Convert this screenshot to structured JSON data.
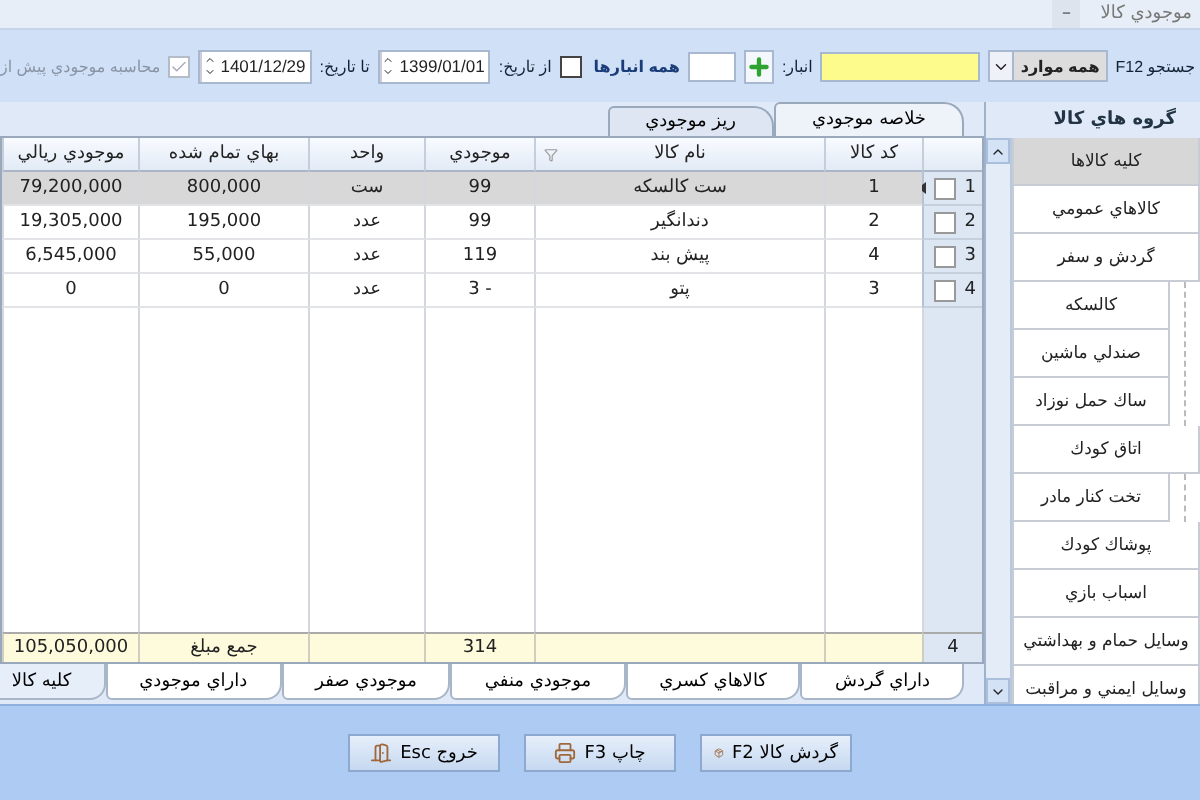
{
  "window": {
    "title": "موجودي كالا",
    "minimize": "–"
  },
  "toolbar": {
    "search_label": "جستجو F12",
    "filter_value": "همه موارد",
    "warehouse_label": "انبار:",
    "all_warehouses": "همه انبارها",
    "from_date": {
      "label": "از تاريخ:",
      "checked": false,
      "value": "1399/01/01"
    },
    "to_date": {
      "label": "تا تاريخ:",
      "value": "1401/12/29"
    },
    "pre_calc": {
      "label": "محاسبه موجودي پيش از",
      "checked": true,
      "disabled": true
    }
  },
  "tabs": [
    {
      "label": "خلاصه موجودي",
      "selected": true
    },
    {
      "label": "ريز موجودي",
      "selected": false
    }
  ],
  "table": {
    "columns": [
      "كد كالا",
      "نام كالا",
      "موجودي",
      "واحد",
      "بهاي تمام شده",
      "موجودي ريالي"
    ],
    "rows": [
      {
        "number": "1",
        "checked": false,
        "selected": true,
        "cells": [
          "1",
          "ست كالسكه",
          "99",
          "ست",
          "800,000",
          "79,200,000"
        ]
      },
      {
        "number": "2",
        "checked": false,
        "selected": false,
        "cells": [
          "2",
          "دندانگير",
          "99",
          "عدد",
          "195,000",
          "19,305,000"
        ]
      },
      {
        "number": "3",
        "checked": false,
        "selected": false,
        "cells": [
          "4",
          "پيش بند",
          "119",
          "عدد",
          "55,000",
          "6,545,000"
        ]
      },
      {
        "number": "4",
        "checked": false,
        "selected": false,
        "cells": [
          "3",
          "پتو",
          "- 3",
          "عدد",
          "0",
          "0"
        ]
      }
    ],
    "footer": {
      "count": "4",
      "quantity": "314",
      "total_label": "جمع مبلغ",
      "amount": "105,050,000"
    }
  },
  "bottom_tabs": [
    {
      "label": "داراي گردش",
      "selected": false
    },
    {
      "label": "كالاهاي كسري",
      "selected": false
    },
    {
      "label": "موجودي منفي",
      "selected": false
    },
    {
      "label": "موجودي صفر",
      "selected": false
    },
    {
      "label": "داراي موجودي",
      "selected": false
    },
    {
      "label": "كليه كالا",
      "selected": true
    }
  ],
  "groups": {
    "title": "گروه هاي كالا",
    "items": [
      {
        "label": "كليه كالاها",
        "selected": true
      },
      {
        "label": "كالاهاي عمومي",
        "selected": false
      },
      {
        "label": "گردش و سفر",
        "selected": false,
        "children": [
          {
            "label": "كالسكه",
            "selected": false
          },
          {
            "label": "صندلي ماشين",
            "selected": false
          },
          {
            "label": "ساك حمل نوزاد",
            "selected": false
          }
        ]
      },
      {
        "label": "اتاق كودك",
        "selected": false,
        "children": [
          {
            "label": "تخت كنار مادر",
            "selected": false
          }
        ]
      },
      {
        "label": "پوشاك كودك",
        "selected": false
      },
      {
        "label": "اسباب بازي",
        "selected": false
      },
      {
        "label": "وسايل حمام و بهداشتي",
        "selected": false
      },
      {
        "label": "وسايل ايمني و مراقبت",
        "selected": false
      }
    ]
  },
  "buttons": [
    {
      "label": "گردش كالا F2",
      "kind": "move"
    },
    {
      "label": "چاپ F3",
      "kind": "print"
    },
    {
      "label": "خروج Esc",
      "kind": "exit"
    }
  ]
}
